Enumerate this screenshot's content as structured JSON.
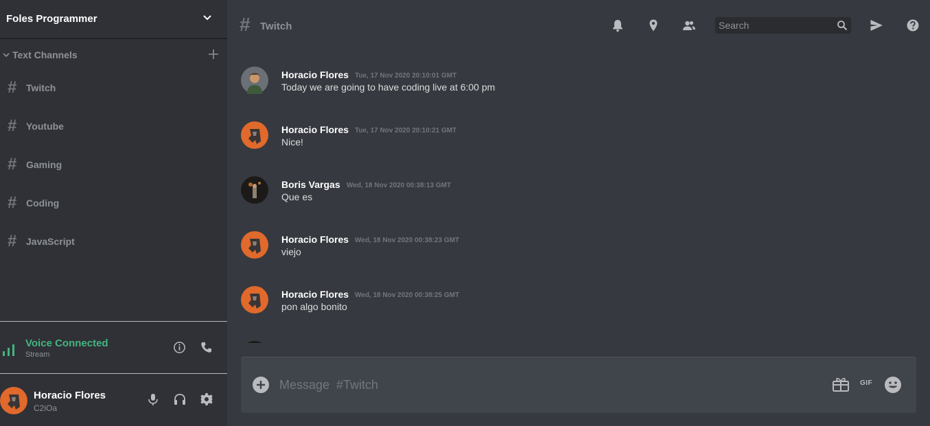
{
  "server": {
    "name": "Foles Programmer"
  },
  "category": {
    "label": "Text Channels"
  },
  "channels": [
    {
      "label": "Twitch"
    },
    {
      "label": "Youtube"
    },
    {
      "label": "Gaming"
    },
    {
      "label": "Coding"
    },
    {
      "label": "JavaScript"
    }
  ],
  "voice": {
    "title": "Voice Connected",
    "subtitle": "Stream"
  },
  "user": {
    "name": "Horacio Flores",
    "tag": "C2iOa"
  },
  "topbar": {
    "hash": "#",
    "channel": "Twitch",
    "search_placeholder": "Search"
  },
  "messages": [
    {
      "author": "Horacio Flores",
      "time": "Tue, 17 Nov 2020 20:10:01 GMT",
      "text": "Today we are going to have coding live at 6:00 pm"
    },
    {
      "author": "Horacio Flores",
      "time": "Tue, 17 Nov 2020 20:10:21 GMT",
      "text": "Nice!"
    },
    {
      "author": "Boris Vargas",
      "time": "Wed, 18 Nov 2020 00:38:13 GMT",
      "text": "Que es"
    },
    {
      "author": "Horacio Flores",
      "time": "Wed, 18 Nov 2020 00:38:23 GMT",
      "text": "viejo"
    },
    {
      "author": "Horacio Flores",
      "time": "Wed, 18 Nov 2020 00:38:25 GMT",
      "text": "pon algo bonito"
    }
  ],
  "composer": {
    "placeholder": "Message  #Twitch",
    "gif_label": "GIF"
  },
  "colors": {
    "online_green": "#43b581",
    "avatar_orange": "#e0692b"
  }
}
